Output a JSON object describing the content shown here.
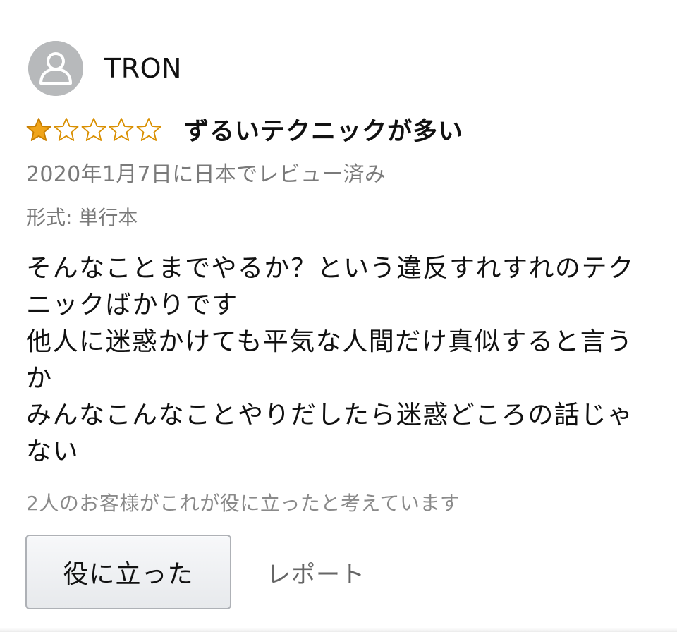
{
  "review": {
    "user": {
      "name": "TRON",
      "avatar_icon": "user-silhouette-icon"
    },
    "rating": {
      "value": 1,
      "max": 5,
      "filled_color": "#f0a51b",
      "empty_color": "#d98f00"
    },
    "title": "ずるいテクニックが多い",
    "date_text": "2020年1月7日に日本でレビュー済み",
    "format_text": "形式: 単行本",
    "body_paragraphs": [
      "そんなことまでやるか？という違反すれすれのテクニックばかりです",
      "他人に迷惑かけても平気な人間だけ真似すると言うか",
      "みんなこんなことやりだしたら迷惑どころの話じゃない"
    ],
    "helpful_text": "2人のお客様がこれが役に立ったと考えています",
    "helpful_button_label": "役に立った",
    "report_label": "レポート"
  }
}
